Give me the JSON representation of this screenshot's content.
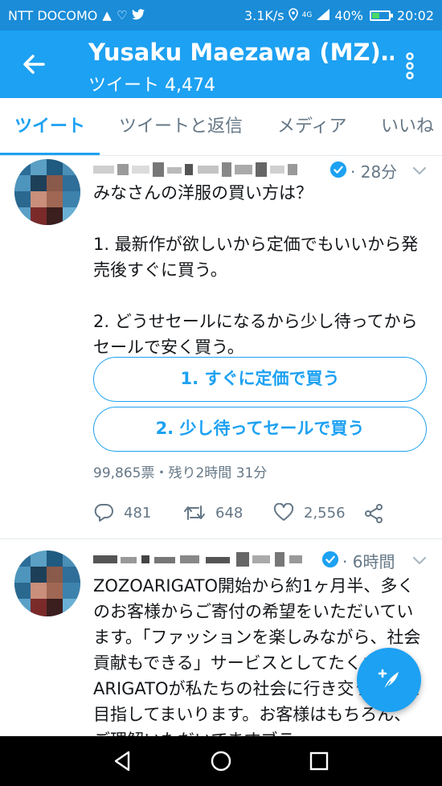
{
  "status_bar": {
    "carrier": "NTT DOCOMO",
    "net_speed": "3.1K/s",
    "signal_label": "4G",
    "battery": "40%",
    "battery_level": 0.4,
    "time": "20:02"
  },
  "header": {
    "title": "Yusaku Maezawa (MZ)…",
    "subtitle": "ツイート 4,474"
  },
  "tabs": [
    {
      "label": "ツイート",
      "active": true
    },
    {
      "label": "ツイートと返信",
      "active": false
    },
    {
      "label": "メディア",
      "active": false
    },
    {
      "label": "いいね",
      "active": false
    }
  ],
  "tweets": [
    {
      "time": "· 28分",
      "text": "みなさんの洋服の買い方は？\n\n1. 最新作が欲しいから定価でもいいから発売後すぐに買う。\n\n2. どうせセールになるから少し待ってからセールで安く買う。",
      "poll_options": [
        "1. すぐに定価で買う",
        "2. 少し待ってセールで買う"
      ],
      "poll_info": "99,865票・残り2時間 31分",
      "replies": "481",
      "retweets": "648",
      "likes": "2,556"
    },
    {
      "time": "· 6時間",
      "text": "ZOZOARIGATO開始から約1ヶ月半、多くのお客様からご寄付の希望をいただいています。「ファッションを楽しみながら、社会貢献もできる」サービスとしてたくさんのARIGATOが私たちの社会に行き交うことを目指してまいります。お客様はもちろん、ご理解いただいてますブラ"
    }
  ],
  "colors": {
    "brand": "#1da1f2",
    "status_bar": "#1a8cd8",
    "secondary_text": "#657786"
  }
}
